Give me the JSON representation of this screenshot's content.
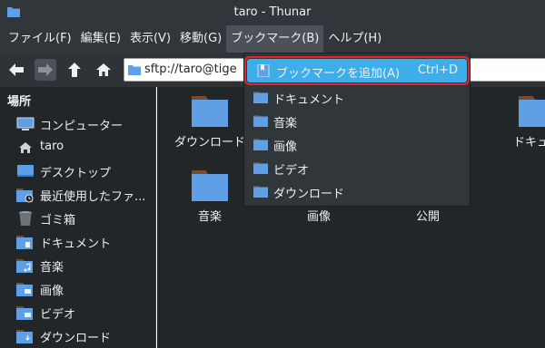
{
  "window": {
    "title": "taro - Thunar"
  },
  "menubar": {
    "items": [
      "ファイル(F)",
      "編集(E)",
      "表示(V)",
      "移動(G)",
      "ブックマーク(B)",
      "ヘルプ(H)"
    ],
    "open_index": 4
  },
  "toolbar": {
    "location_text": "sftp://taro@tige"
  },
  "sidebar": {
    "section_title": "場所",
    "items": [
      {
        "label": "コンピューター",
        "icon": "computer-icon"
      },
      {
        "label": "taro",
        "icon": "home-icon"
      },
      {
        "label": "デスクトップ",
        "icon": "desktop-icon"
      },
      {
        "label": "最近使用したファ...",
        "icon": "recent-icon"
      },
      {
        "label": "ゴミ箱",
        "icon": "trash-icon"
      },
      {
        "label": "ドキュメント",
        "icon": "documents-folder-icon"
      },
      {
        "label": "音楽",
        "icon": "music-folder-icon"
      },
      {
        "label": "画像",
        "icon": "pictures-folder-icon"
      },
      {
        "label": "ビデオ",
        "icon": "videos-folder-icon"
      },
      {
        "label": "ダウンロード",
        "icon": "downloads-folder-icon"
      }
    ]
  },
  "files": [
    {
      "label": "ダウンロード"
    },
    {
      "label": "ドキュメ"
    },
    {
      "label": "音楽"
    },
    {
      "label": "画像"
    },
    {
      "label": "公開"
    }
  ],
  "bookmark_menu": {
    "add_label": "ブックマークを追加(A)",
    "add_shortcut": "Ctrl+D",
    "items": [
      "ドキュメント",
      "音楽",
      "画像",
      "ビデオ",
      "ダウンロード"
    ]
  },
  "colors": {
    "folder": "#5e9fe6",
    "folder_tab": "#7a4a2a",
    "highlight": "#3daee9",
    "highlight_outline": "#e3262d"
  }
}
